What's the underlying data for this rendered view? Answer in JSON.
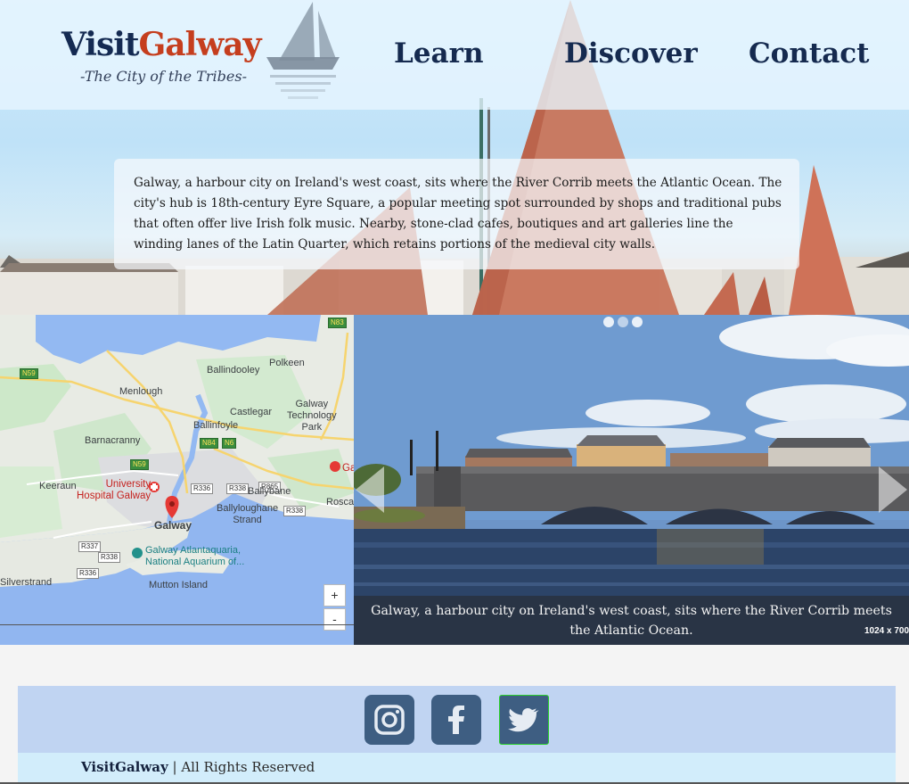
{
  "header": {
    "logo_part1": "Visit",
    "logo_part2": "Galway",
    "tagline": "-The City of the Tribes-",
    "nav": {
      "learn": "Learn",
      "discover": "Discover",
      "contact": "Contact"
    }
  },
  "intro": {
    "text": "Galway, a harbour city on Ireland's west coast, sits where the River Corrib meets the Atlantic Ocean. The city's hub is 18th-century Eyre Square, a popular meeting spot surrounded by shops and traditional pubs that often offer live Irish folk music. Nearby, stone-clad cafes, boutiques and art galleries line the winding lanes of the Latin Quarter, which retains portions of the medieval city walls."
  },
  "map": {
    "labels": {
      "polkeen": "Polkeen",
      "ballindooley": "Ballindooley",
      "menlough": "Menlough",
      "galway_tech_park": "Galway\nTechnology\nPark",
      "castlegar": "Castlegar",
      "ballinfoyle": "Ballinfoyle",
      "barnacranny": "Barnacranny",
      "keeraun": "Keeraun",
      "university_hospital": "University\nHospital Galway",
      "galway": "Galway",
      "ballybane": "Ballybane",
      "ballyloughane": "Ballyloughane\nStrand",
      "roscam": "Roscam",
      "aquarium": "Galway Atlantaquaria,\nNational Aquarium of...",
      "silverstrand": "Silverstrand",
      "mutton_island": "Mutton Island",
      "galway_clinic_partial": "Ga"
    },
    "shields": {
      "n83": "N83",
      "n59_a": "N59",
      "n59_b": "N59",
      "n84": "N84",
      "n6": "N6",
      "r336_a": "R336",
      "r338_a": "R338",
      "r865": "R865",
      "r338_b": "R338",
      "r337": "R337",
      "r338_c": "R338",
      "r336_b": "R336"
    },
    "zoom_in": "+",
    "zoom_out": "-"
  },
  "carousel": {
    "slide_count": 3,
    "active_index": 1,
    "caption": "Galway, a harbour city on Ireland's west coast, sits where the River Corrib meets the Atlantic Ocean.",
    "dimension": "1024 x 700"
  },
  "footer": {
    "social": [
      "instagram",
      "facebook",
      "twitter"
    ],
    "brand": "VisitGalway",
    "rights": " | All Rights Reserved"
  },
  "colors": {
    "navy": "#142a52",
    "accent_red": "#c53e1e",
    "social_bg": "#3e5e82",
    "social_band": "#c0d4f2",
    "copyright_band": "#d2edfb"
  }
}
